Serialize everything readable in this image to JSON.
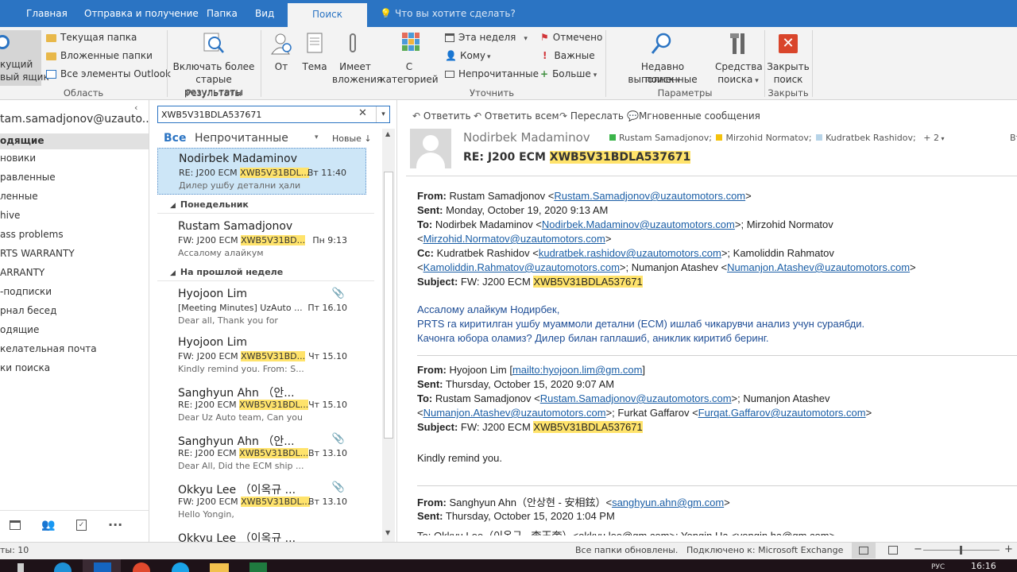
{
  "ribbon_tabs": [
    "Главная",
    "Отправка и получение",
    "Папка",
    "Вид",
    "Поиск"
  ],
  "tell_me": "Что вы хотите сделать?",
  "ribbon": {
    "scope": {
      "current_mailbox_l1": "кущий",
      "current_mailbox_l2": "вый ящик",
      "current_folder": "Текущая папка",
      "subfolders": "Вложенные папки",
      "all_outlook": "Все элементы Outlook",
      "group": "Область"
    },
    "results": {
      "include_older_l1": "Включать более",
      "include_older_l2": "старые результаты",
      "group": "Результаты"
    },
    "refine": {
      "from": "От",
      "subject": "Тема",
      "has_attach_l1": "Имеет",
      "has_attach_l2": "вложения",
      "categorized": "С категорией",
      "this_week": "Эта неделя",
      "to": "Кому",
      "unread": "Непрочитанные",
      "flagged": "Отмечено",
      "important": "Важные",
      "more": "Больше",
      "group": "Уточнить"
    },
    "options": {
      "recent_l1": "Недавно выполненные",
      "recent_l2": "поиск",
      "tools_l1": "Средства",
      "tools_l2": "поиска",
      "group": "Параметры"
    },
    "close": {
      "label_l1": "Закрыть",
      "label_l2": "поиск",
      "group": "Закрыть"
    }
  },
  "folders": {
    "account": "tam.samadjonov@uzauto...",
    "items": [
      "одящие",
      "новики",
      "равленные",
      "ленные",
      "hive",
      "ass problems",
      "RTS WARRANTY",
      "ARRANTY",
      "-подписки",
      "рнал бесед",
      "одящие",
      "келательная почта",
      "ки поиска"
    ]
  },
  "search": {
    "query": "XWB5V31BDLA537671"
  },
  "list": {
    "filter_all": "Все",
    "filter_unread": "Непрочитанные",
    "sort": "Новые",
    "groups": [
      "Понедельник",
      "На прошлой неделе"
    ],
    "messages": [
      {
        "sender": "Nodirbek Madaminov",
        "subj_prefix": "RE: J200 ECM ",
        "subj_hl": "XWB5V31BDL...",
        "preview": "Дилер ушбу детални ҳали",
        "date": "Вт 11:40",
        "attach": false
      },
      {
        "sender": "Rustam Samadjonov",
        "subj_prefix": "FW: J200 ECM ",
        "subj_hl": "XWB5V31BD...",
        "preview": "Ассалому алайкум",
        "date": "Пн 9:13",
        "attach": false
      },
      {
        "sender": "Hyojoon Lim",
        "subj_prefix": "[Meeting Minutes] UzAuto ...",
        "subj_hl": "",
        "preview": "Dear all,  Thank you for",
        "date": "Пт 16.10",
        "attach": true
      },
      {
        "sender": "Hyojoon Lim",
        "subj_prefix": "FW: J200 ECM ",
        "subj_hl": "XWB5V31BD...",
        "preview": "Kindly remind you. From: S...",
        "date": "Чт 15.10",
        "attach": false
      },
      {
        "sender": "Sanghyun Ahn （안...",
        "subj_prefix": "RE: J200 ECM ",
        "subj_hl": "XWB5V31BDL...",
        "preview": "Dear Uz Auto team,  Can you",
        "date": "Чт 15.10",
        "attach": false
      },
      {
        "sender": "Sanghyun Ahn （안...",
        "subj_prefix": "RE: J200 ECM ",
        "subj_hl": "XWB5V31BDL...",
        "preview": "Dear All,  Did the ECM ship ...",
        "date": "Вт 13.10",
        "attach": true
      },
      {
        "sender": "Okkyu Lee （이옥규 ...",
        "subj_prefix": "FW: J200 ECM ",
        "subj_hl": "XWB5V31BDL...",
        "preview": "Hello Yongin,",
        "date": "Вт 13.10",
        "attach": true
      },
      {
        "sender": "Okkyu Lee （이옥규 ...",
        "subj_prefix": "",
        "subj_hl": "",
        "preview": "",
        "date": "",
        "attach": false
      }
    ]
  },
  "reading": {
    "actions": {
      "reply": "Ответить",
      "reply_all": "Ответить всем",
      "forward": "Переслать",
      "im": "Мгновенные сообщения"
    },
    "sender": "Nodirbek Madaminov",
    "recipients": [
      "Rustam Samadjonov;",
      "Mirzohid Normatov;",
      "Kudratbek Rashidov;"
    ],
    "more_recipients": "+ 2",
    "subject_prefix": "RE: J200 ECM ",
    "subject_hl": "XWB5V31BDLA537671",
    "corner_text": "Вт",
    "body": {
      "m1_from_lbl": "From:",
      "m1_from": " Rustam Samadjonov <",
      "m1_from_mail": "Rustam.Samadjonov@uzautomotors.com",
      "m1_from_end": ">",
      "m1_sent_lbl": "Sent:",
      "m1_sent": " Monday, October 19, 2020 9:13 AM",
      "m1_to_lbl": "To:",
      "m1_to": " Nodirbek Madaminov <",
      "m1_to_mail1": "Nodirbek.Madaminov@uzautomotors.com",
      "m1_to_mid": ">; Mirzohid Normatov",
      "m1_to2_start": "<",
      "m1_to_mail2": "Mirzohid.Normatov@uzautomotors.com",
      "m1_to2_end": ">",
      "m1_cc_lbl": "Cc:",
      "m1_cc": " Kudratbek Rashidov <",
      "m1_cc_mail1": "kudratbek.rashidov@uzautomotors.com",
      "m1_cc_mid": ">; Kamoliddin Rahmatov",
      "m1_cc2_start": "<",
      "m1_cc_mail2": "Kamoliddin.Rahmatov@uzautomotors.com",
      "m1_cc2_mid": ">; Numanjon Atashev <",
      "m1_cc_mail3": "Numanjon.Atashev@uzautomotors.com",
      "m1_cc2_end": ">",
      "m1_subj_lbl": "Subject:",
      "m1_subj": " FW: J200 ECM ",
      "m1_subj_hl": "XWB5V31BDLA537671",
      "uz1": "Ассалому алайкум Нодирбек,",
      "uz2": "PRTS га киритилган ушбу муаммоли детални (ECM) ишлаб чикарувчи анализ учун сураябди.",
      "uz3": "Качонга юбора оламиз? Дилер билан гаплашиб, аниклик киритиб беринг.",
      "m2_from_lbl": "From:",
      "m2_from": " Hyojoon Lim [",
      "m2_from_mail": "mailto:hyojoon.lim@gm.com",
      "m2_from_end": "]",
      "m2_sent_lbl": "Sent:",
      "m2_sent": " Thursday, October 15, 2020 9:07 AM",
      "m2_to_lbl": "To:",
      "m2_to": " Rustam Samadjonov <",
      "m2_to_mail1": "Rustam.Samadjonov@uzautomotors.com",
      "m2_to_mid": ">; Numanjon Atashev",
      "m2_to2_start": "<",
      "m2_to_mail2": "Numanjon.Atashev@uzautomotors.com",
      "m2_to2_mid": ">; Furkat Gaffarov <",
      "m2_to_mail3": "Furqat.Gaffarov@uzautomotors.com",
      "m2_to2_end": ">",
      "m2_subj_lbl": "Subject:",
      "m2_subj": " FW: J200 ECM ",
      "m2_subj_hl": "XWB5V31BDLA537671",
      "m2_body": "Kindly remind you.",
      "m3_from_lbl": "From:",
      "m3_from": " Sanghyun Ahn（안상현 - 安相鉉）<",
      "m3_from_mail": "sanghyun.ahn@gm.com",
      "m3_from_end": ">",
      "m3_sent_lbl": "Sent:",
      "m3_sent": " Thursday, October 15, 2020 1:04 PM",
      "m3_to_partial": "To: Okkyu Lee（이옥규 - 李玉奎）<okkyu.lee@gm.com>; Yongin Ha <yongin.ha@gm.com>"
    }
  },
  "status": {
    "items": "ты: 10",
    "updated": "Все папки обновлены.",
    "connected": "Подключено к: Microsoft Exchange"
  },
  "taskbar": {
    "time": "16:16",
    "lang": "РУС"
  },
  "colors": {
    "accent": "#2b74c3",
    "highlight": "#ffe36b",
    "selected_row": "#cde6f7",
    "close_red": "#d9452b"
  }
}
